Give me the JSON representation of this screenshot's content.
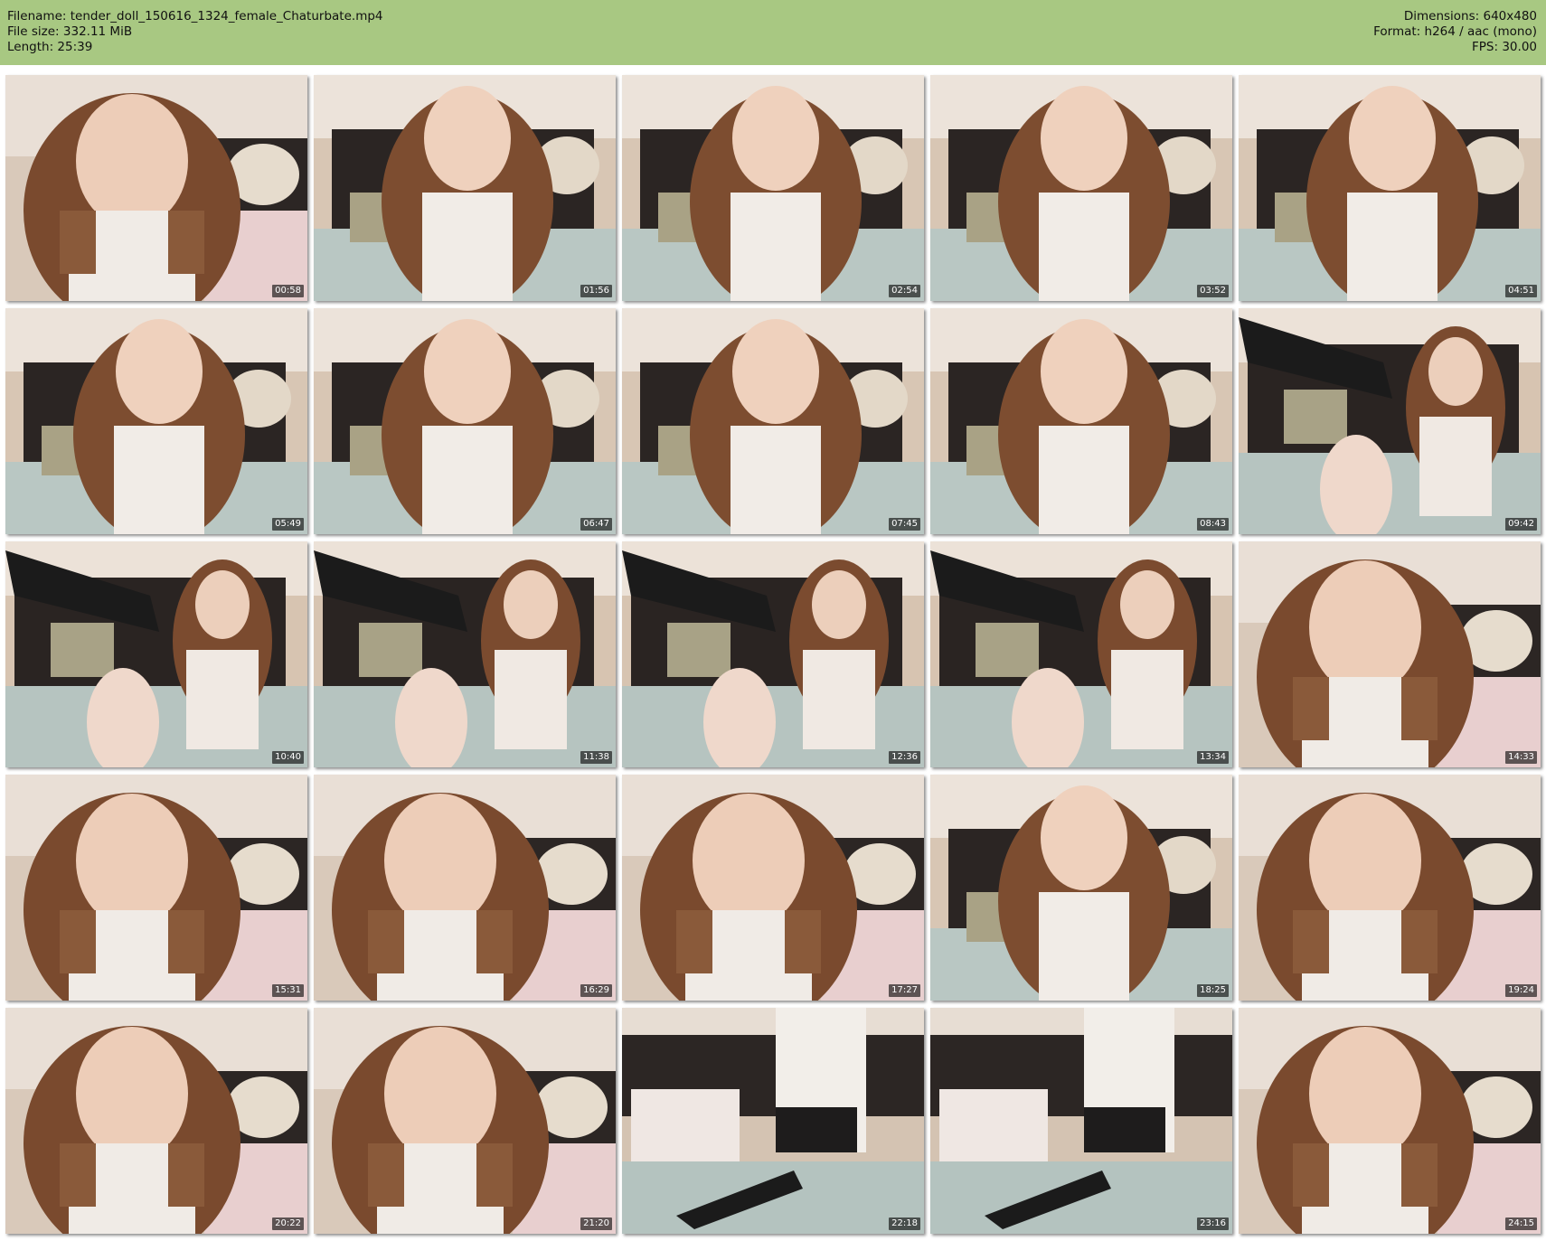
{
  "header": {
    "filename": "Filename: tender_doll_150616_1324_female_Chaturbate.mp4",
    "filesize": "File size: 332.11 MiB",
    "length": "Length: 25:39",
    "dimensions": "Dimensions: 640x480",
    "format": "Format: h264 / aac (mono)",
    "fps": "FPS: 30.00"
  },
  "thumbnails": [
    {
      "time": "00:58",
      "scene": "closeup"
    },
    {
      "time": "01:56",
      "scene": "bed"
    },
    {
      "time": "02:54",
      "scene": "bed"
    },
    {
      "time": "03:52",
      "scene": "bed"
    },
    {
      "time": "04:51",
      "scene": "bed"
    },
    {
      "time": "05:49",
      "scene": "bed"
    },
    {
      "time": "06:47",
      "scene": "bed"
    },
    {
      "time": "07:45",
      "scene": "bed"
    },
    {
      "time": "08:43",
      "scene": "bed"
    },
    {
      "time": "09:42",
      "scene": "legs"
    },
    {
      "time": "10:40",
      "scene": "legs"
    },
    {
      "time": "11:38",
      "scene": "legs"
    },
    {
      "time": "12:36",
      "scene": "legs"
    },
    {
      "time": "13:34",
      "scene": "legs"
    },
    {
      "time": "14:33",
      "scene": "closeup"
    },
    {
      "time": "15:31",
      "scene": "closeup"
    },
    {
      "time": "16:29",
      "scene": "closeup"
    },
    {
      "time": "17:27",
      "scene": "closeup"
    },
    {
      "time": "18:25",
      "scene": "bed"
    },
    {
      "time": "19:24",
      "scene": "closeup"
    },
    {
      "time": "20:22",
      "scene": "closeup"
    },
    {
      "time": "21:20",
      "scene": "closeup"
    },
    {
      "time": "22:18",
      "scene": "room"
    },
    {
      "time": "23:16",
      "scene": "room"
    },
    {
      "time": "24:15",
      "scene": "closeup"
    }
  ]
}
